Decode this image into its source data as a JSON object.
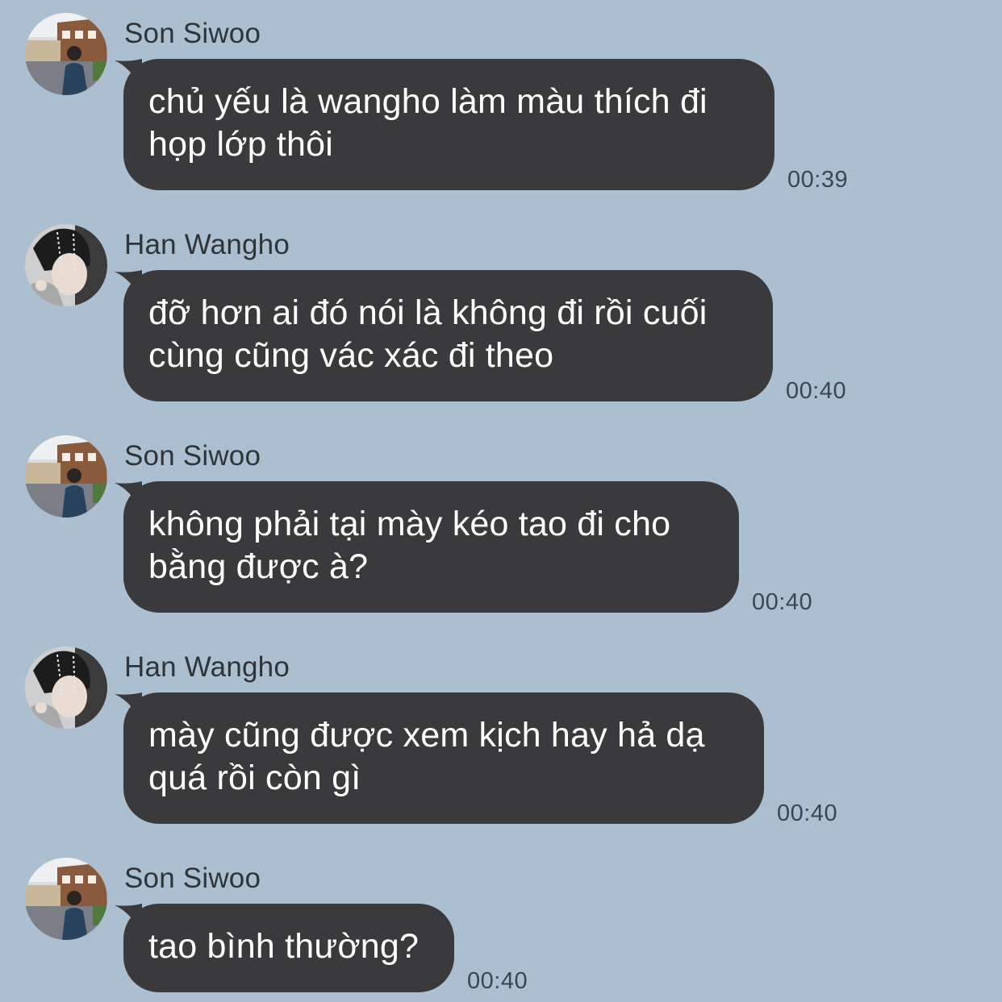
{
  "colors": {
    "background": "#acbfd0",
    "bubble": "#3a3a3c",
    "bubble_text": "#ffffff",
    "sender_text": "#2f3439",
    "time_text": "#3b4652"
  },
  "messages": [
    {
      "sender": "Son Siwoo",
      "avatar": "avatar-son-siwoo-photo",
      "text": "chủ yếu là wangho làm màu thích đi\nhọp lớp thôi",
      "time": "00:39"
    },
    {
      "sender": "Han Wangho",
      "avatar": "avatar-han-wangho-photo",
      "text": "đỡ hơn ai đó nói là không đi rồi cuối\ncùng cũng vác xác đi theo",
      "time": "00:40"
    },
    {
      "sender": "Son Siwoo",
      "avatar": "avatar-son-siwoo-photo",
      "text": "không phải tại mày kéo tao đi cho\nbằng được à?",
      "time": "00:40"
    },
    {
      "sender": "Han Wangho",
      "avatar": "avatar-han-wangho-photo",
      "text": "mày cũng được xem kịch hay hả dạ\nquá rồi còn gì",
      "time": "00:40"
    },
    {
      "sender": "Son Siwoo",
      "avatar": "avatar-son-siwoo-photo",
      "text": "tao bình thường?",
      "time": "00:40"
    }
  ]
}
